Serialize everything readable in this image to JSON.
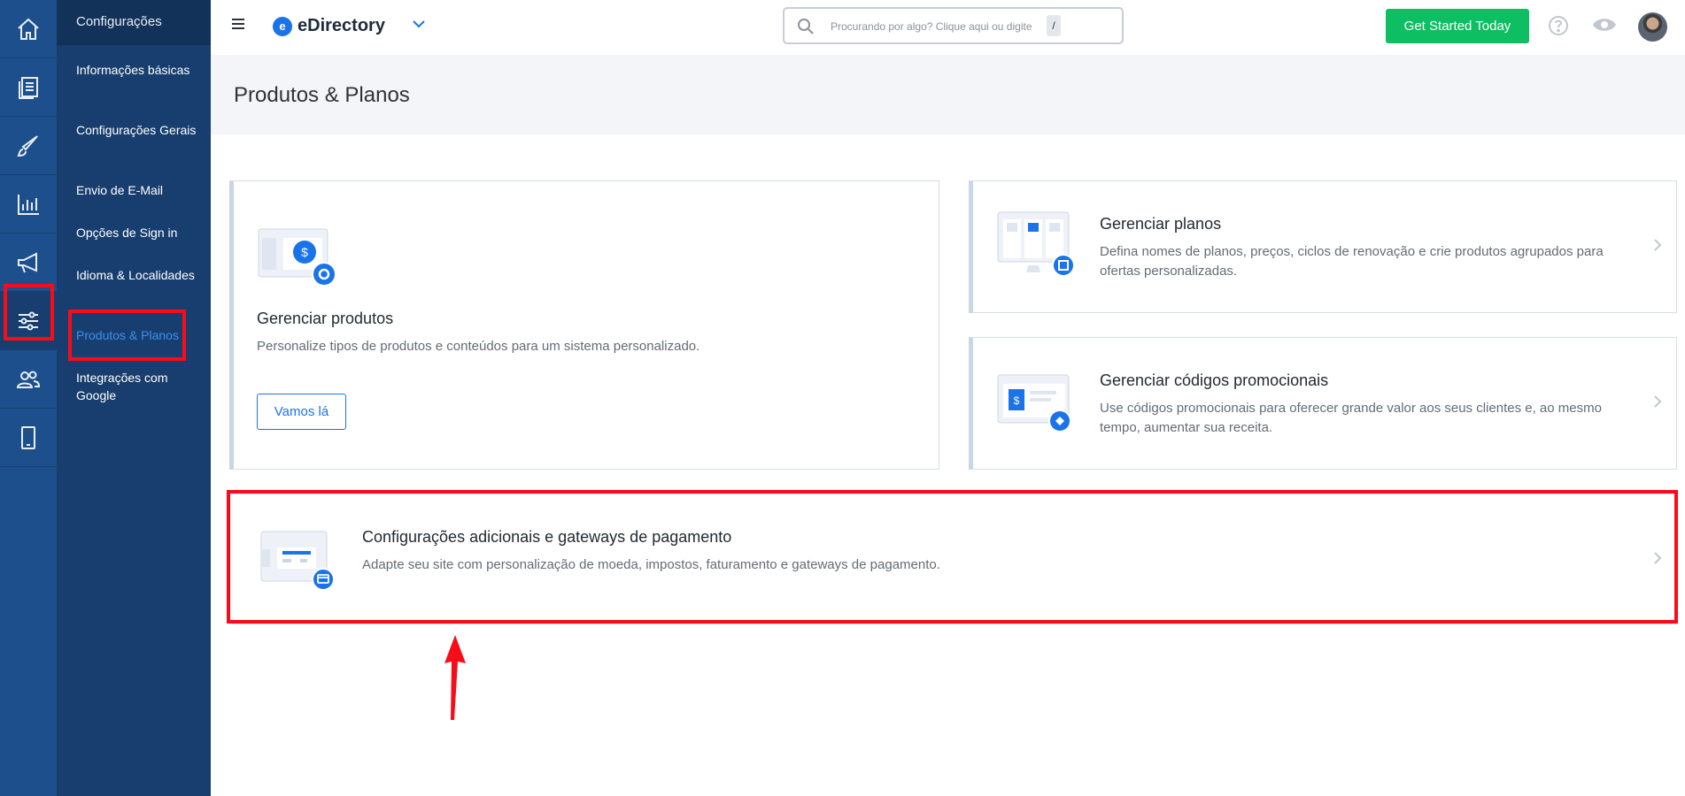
{
  "app": {
    "brand": "eDirectory",
    "brand_letter": "e"
  },
  "search": {
    "placeholder": "Procurando por algo? Clique aqui ou digite",
    "shortcut": "/"
  },
  "header": {
    "cta_label": "Get Started Today"
  },
  "settings_nav": {
    "title": "Configurações",
    "items": [
      {
        "label": "Informações básicas"
      },
      {
        "label": "Configurações Gerais"
      },
      {
        "label": "Envio de E-Mail"
      },
      {
        "label": "Opções de Sign in"
      },
      {
        "label": "Idioma & Localidades"
      },
      {
        "label": "Produtos & Planos"
      },
      {
        "label": "Integrações com Google"
      }
    ],
    "active": "Produtos & Planos"
  },
  "page": {
    "title": "Produtos & Planos"
  },
  "cards": {
    "products": {
      "title": "Gerenciar produtos",
      "desc": "Personalize tipos de produtos e conteúdos para um sistema personalizado.",
      "button": "Vamos lá"
    },
    "plans": {
      "title": "Gerenciar planos",
      "desc": "Defina nomes de planos, preços, ciclos de renovação e crie produtos agrupados para ofertas personalizadas."
    },
    "promo": {
      "title": "Gerenciar códigos promocionais",
      "desc": "Use códigos promocionais para oferecer grande valor aos seus clientes e, ao mesmo tempo, aumentar sua receita."
    },
    "gateways": {
      "title": "Configurações adicionais e gateways de pagamento",
      "desc": "Adapte seu site com personalização de moeda, impostos, faturamento e gateways de pagamento."
    }
  },
  "icons": [
    "home-icon",
    "pages-icon",
    "brush-icon",
    "chart-icon",
    "megaphone-icon",
    "sliders-icon",
    "users-icon",
    "mobile-icon",
    "search-icon",
    "chevron-down-icon",
    "help-icon",
    "eye-icon",
    "chevron-right-icon"
  ],
  "colors": {
    "accent": "#1a73e8",
    "cta": "#0dbe62",
    "sidebar": "#1d4f8c",
    "annotation": "#f70d1a"
  }
}
